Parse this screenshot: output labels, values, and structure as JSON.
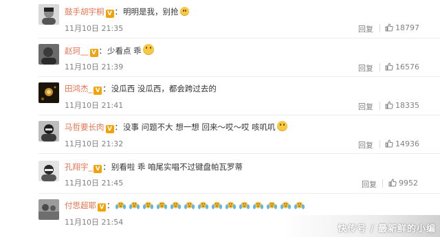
{
  "comments": [
    {
      "username": "鼓手胡宇桐",
      "verified": "V",
      "text": "明明是我，别抢",
      "emoji": "smile-emoji",
      "time": "11月10日 21:35",
      "reply_label": "回复",
      "likes": "18797"
    },
    {
      "username": "赵珂__",
      "verified": "V",
      "text": "少看点 乖",
      "emoji": "smile-emoji",
      "time": "11月10日 21:39",
      "reply_label": "回复",
      "likes": "16576"
    },
    {
      "username": "田鸿杰_",
      "verified": "V",
      "text": "没瓜西 没瓜西，都会跨过去的",
      "time": "11月10日 21:41",
      "reply_label": "回复",
      "likes": "18335"
    },
    {
      "username": "马哲要长肉",
      "verified": "V",
      "text": "没事 问题不大 想一想 回来～哎～哎 咳叽叽",
      "emoji": "thumbs-emoji",
      "time": "11月10日 21:32",
      "reply_label": "回复",
      "likes": "14936"
    },
    {
      "username": "孔翔宇_",
      "verified": "V",
      "text": "别看啦 乖 咱尾实唱不过键盘帕瓦罗蒂",
      "time": "11月10日 21:45",
      "reply_label": "回复",
      "likes": "9952"
    },
    {
      "username": "付思超耶",
      "verified": "V",
      "emoji": "laughing-tears-emoji",
      "emoji_count": 14,
      "time": "11月10日 21:54"
    }
  ],
  "watermark": "快传号 / 最新鲜的小编",
  "colors": {
    "username": "#eb7350",
    "meta": "#808080",
    "badge": "#f3a20a"
  }
}
